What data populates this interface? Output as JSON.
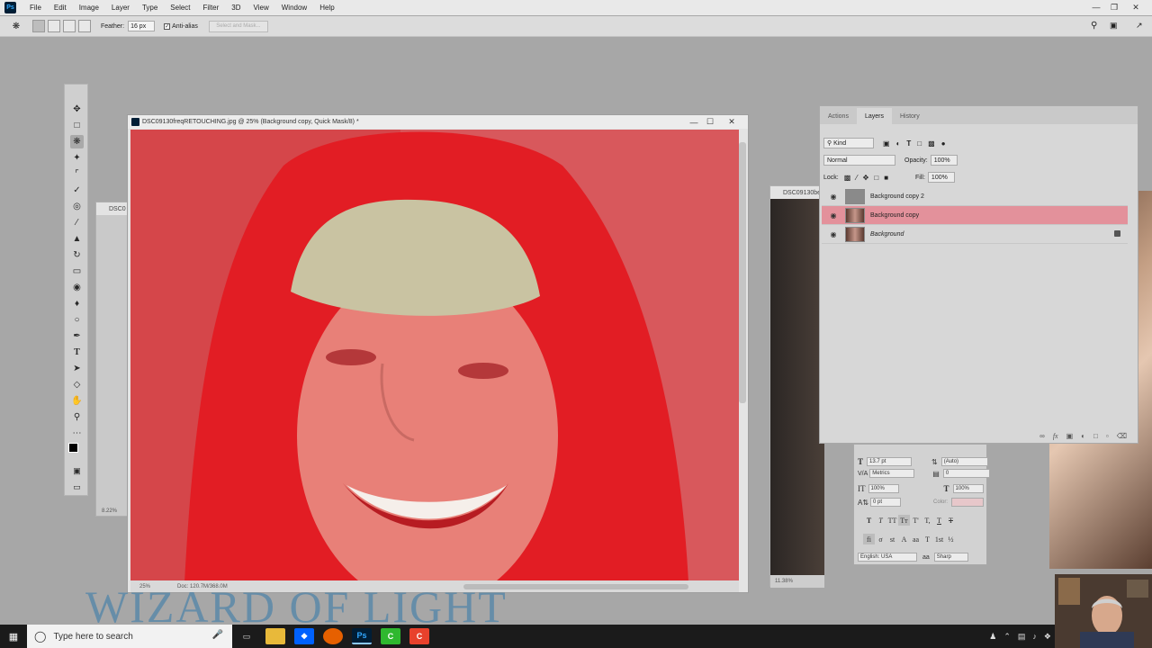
{
  "menubar": {
    "items": [
      "File",
      "Edit",
      "Image",
      "Layer",
      "Type",
      "Select",
      "Filter",
      "3D",
      "View",
      "Window",
      "Help"
    ]
  },
  "options": {
    "feather_label": "Feather:",
    "feather_value": "16 px",
    "antialias_label": "Anti-alias",
    "select_mask_label": "Select and Mask..."
  },
  "main_doc": {
    "title": "DSC09130freqRETOUCHING.jpg @ 25% (Background copy, Quick Mask/8) *",
    "zoom": "25%",
    "doc_info": "Doc: 120.7M/368.0M"
  },
  "bg_docs": {
    "left_title": "DSC0",
    "left_zoom": "8.22%",
    "right_title": "DSC09130be",
    "right_zoom": "11.38%"
  },
  "layers_panel": {
    "tabs": [
      "Actions",
      "Layers",
      "History"
    ],
    "active_tab": "Layers",
    "kind_label": "Kind",
    "blend_mode": "Normal",
    "opacity_label": "Opacity:",
    "opacity_value": "100%",
    "lock_label": "Lock:",
    "fill_label": "Fill:",
    "fill_value": "100%",
    "layers": [
      {
        "name": "Background copy 2",
        "selected": false,
        "locked": false
      },
      {
        "name": "Background copy",
        "selected": true,
        "locked": false
      },
      {
        "name": "Background",
        "selected": false,
        "locked": true
      }
    ],
    "selected_color": "#e3919b"
  },
  "char_panel": {
    "font_size": "13.7 pt",
    "leading": "(Auto)",
    "kerning": "Metrics",
    "tracking": "0",
    "vscale": "100%",
    "hscale": "100%",
    "baseline": "0 pt",
    "color_label": "Color:",
    "language": "English: USA",
    "aa_method": "Sharp",
    "aa_icon": "aa"
  },
  "taskbar": {
    "search_placeholder": "Type here to search"
  },
  "watermark": "WIZARD OF LIGHT",
  "colors": {
    "quick_mask": "#d8242a",
    "ps_dark": "#001e36",
    "ps_blue": "#31a8ff"
  }
}
